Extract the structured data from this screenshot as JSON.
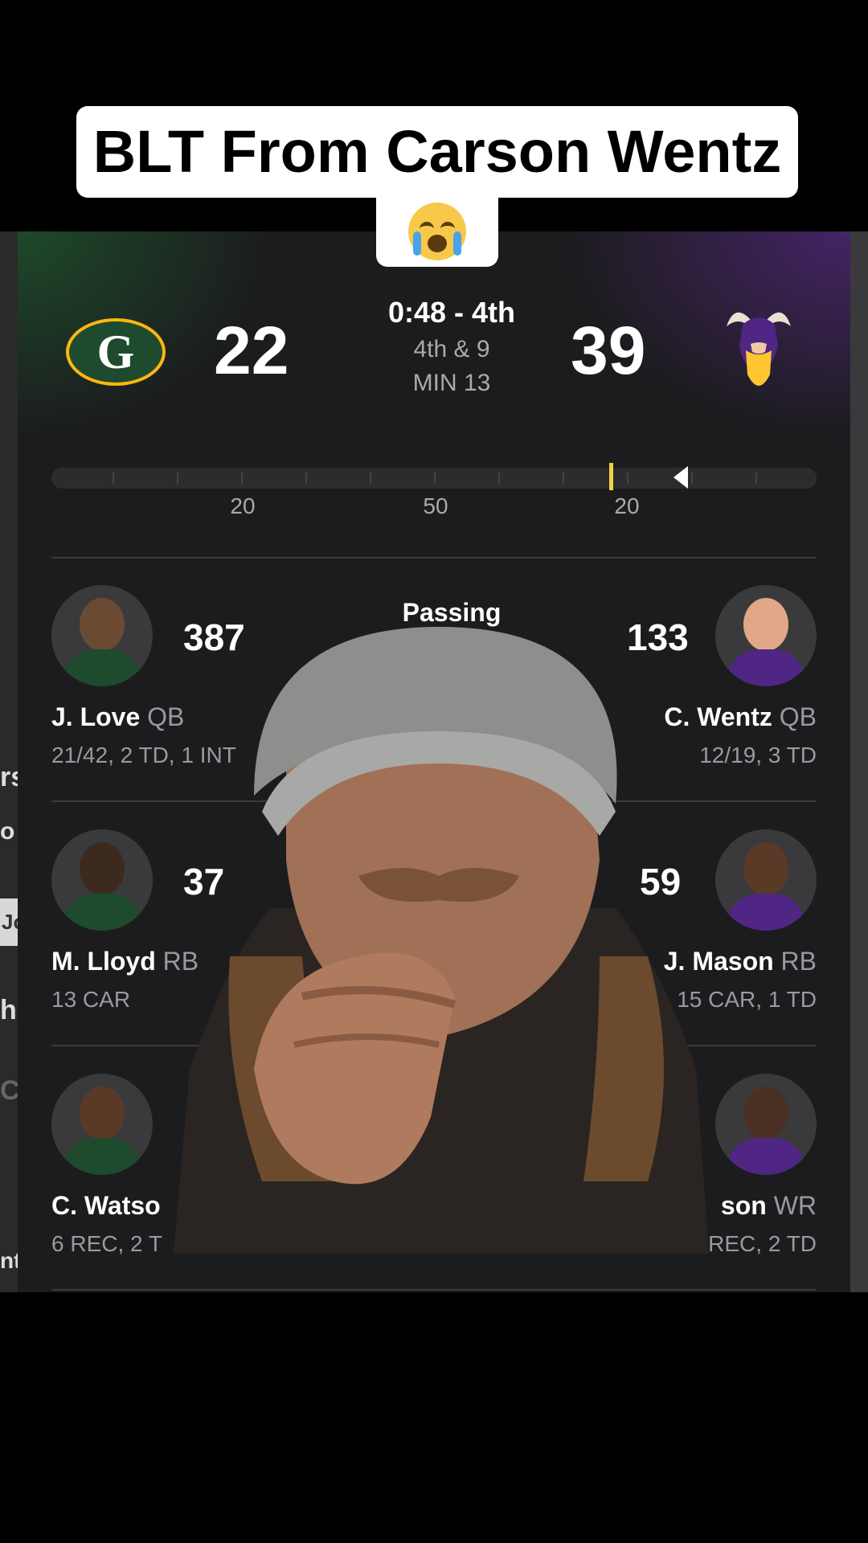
{
  "caption": {
    "line1": "BLT From Carson Wentz",
    "emoji": "loudly-crying-face"
  },
  "game": {
    "home_team": {
      "abbr": "GB",
      "logo_icon": "packers-logo-icon",
      "score": "22",
      "color": "#1e4a2e"
    },
    "away_team": {
      "abbr": "MIN",
      "logo_icon": "vikings-logo-icon",
      "score": "39",
      "color": "#4f2683"
    },
    "clock": "0:48 - 4th",
    "down_distance": "4th & 9",
    "ball_on": "MIN 13",
    "field_labels": [
      "20",
      "50",
      "20"
    ]
  },
  "section": {
    "title": "Passing"
  },
  "leaders": [
    {
      "home": {
        "stat": "387",
        "name": "J. Love",
        "pos": "QB",
        "line": "21/42, 2 TD, 1 INT"
      },
      "away": {
        "stat": "133",
        "name": "C. Wentz",
        "pos": "QB",
        "line": "12/19, 3 TD"
      }
    },
    {
      "home": {
        "stat": "37",
        "name": "M. Lloyd",
        "pos": "RB",
        "line": "13 CAR"
      },
      "away": {
        "stat": "59",
        "name": "J. Mason",
        "pos": "RB",
        "line": "15 CAR, 1 TD"
      }
    },
    {
      "home": {
        "stat": "",
        "name": "C. Watso",
        "pos": "",
        "line": "6 REC, 2 T"
      },
      "away": {
        "stat": "",
        "name": "son",
        "pos": "WR",
        "line": "8 REC, 2 TD"
      }
    }
  ],
  "left_sliver_glyphs": [
    "rs",
    "o",
    "Jo",
    "h",
    "C",
    "nt"
  ]
}
